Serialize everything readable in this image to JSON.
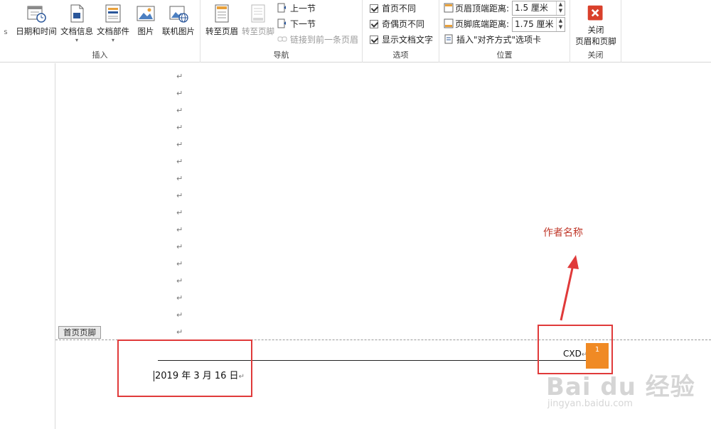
{
  "ribbon": {
    "groups": {
      "insert": {
        "label": "插入",
        "buttons": [
          {
            "label": "日期和时间"
          },
          {
            "label": "文档信息",
            "has_dropdown": true
          },
          {
            "label": "文档部件",
            "has_dropdown": true
          },
          {
            "label": "图片"
          },
          {
            "label": "联机图片"
          }
        ]
      },
      "navigation": {
        "label": "导航",
        "goto_header": "转至页眉",
        "goto_footer": "转至页脚",
        "prev_section": "上一节",
        "next_section": "下一节",
        "link_previous": "链接到前一条页眉"
      },
      "options": {
        "label": "选项",
        "items": [
          {
            "label": "首页不同",
            "checked": true
          },
          {
            "label": "奇偶页不同",
            "checked": true
          },
          {
            "label": "显示文档文字",
            "checked": true
          }
        ]
      },
      "position": {
        "label": "位置",
        "header_top_label": "页眉顶端距离:",
        "header_top_value": "1.5 厘米",
        "footer_bottom_label": "页脚底端距离:",
        "footer_bottom_value": "1.75 厘米",
        "insert_align_tab": "插入\"对齐方式\"选项卡"
      },
      "close": {
        "label": "关闭",
        "button_line1": "关闭",
        "button_line2": "页眉和页脚"
      }
    },
    "colors": {
      "close_red": "#d9402b",
      "accent_blue": "#2b579a"
    }
  },
  "document": {
    "paragraph_mark": "↵",
    "footer_tag": "首页页脚",
    "footer_date": "2019 年 3 月 16 日",
    "footer_author": "CXD",
    "page_number": "1"
  },
  "annotation": {
    "text": "作者名称",
    "color": "#c0392b"
  },
  "watermark": {
    "brand": "Bai du 经验",
    "sub": "jingyan.baidu.com"
  }
}
